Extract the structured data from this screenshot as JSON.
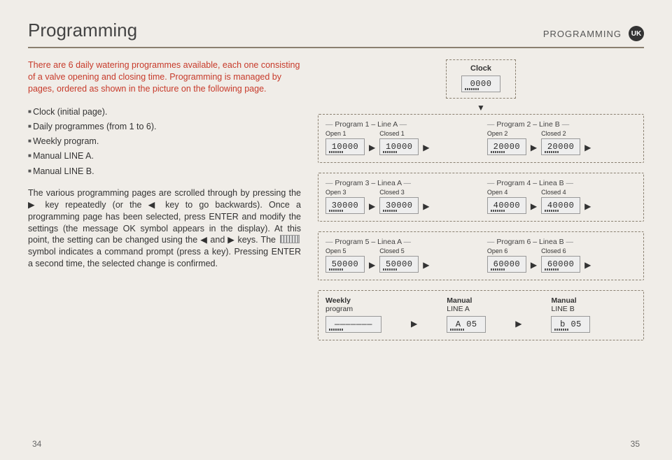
{
  "header": {
    "title": "Programming",
    "subtitle": "PROGRAMMING",
    "badge": "UK"
  },
  "intro": "There are 6 daily watering programmes available, each one consisting of a valve opening and closing time. Programming is managed by pages, ordered as shown in the picture on the following page.",
  "bullets": [
    "Clock (initial page).",
    "Daily programmes (from 1 to 6).",
    "Weekly program.",
    "Manual LINE A.",
    "Manual LINE B."
  ],
  "body": "The various programming pages are scrolled through by pressing the ▶ key repeatedly (or the ◀ key to go backwards). Once a programming page has been selected, press ENTER and modify the settings (the message OK symbol appears in the display). At this point, the setting can be changed using the ◀ and ▶ keys. The  symbol indicates a command prompt (press a key). Pressing ENTER a second time, the selected change is confirmed.",
  "body_before_sym": "The various programming pages are scrolled through by pressing the ▶ key repeatedly (or the ◀ key to go backwards). Once a programming page has been selected, press ENTER and modify the settings (the message OK symbol appears in the display). At this point, the setting can be changed using the ◀ and ▶ keys. The ",
  "body_after_sym": " symbol indicates a command prompt (press a key). Pressing ENTER a second time, the selected change is confirmed.",
  "clock": {
    "label": "Clock",
    "value": "0000"
  },
  "programs": [
    {
      "left": {
        "title": "Program 1 – Line A",
        "open_l": "Open 1",
        "open_v": "10000",
        "close_l": "Closed 1",
        "close_v": "10000"
      },
      "right": {
        "title": "Program 2 – Line B",
        "open_l": "Open 2",
        "open_v": "20000",
        "close_l": "Closed 2",
        "close_v": "20000"
      }
    },
    {
      "left": {
        "title": "Program 3 – Linea A",
        "open_l": "Open 3",
        "open_v": "30000",
        "close_l": "Closed 3",
        "close_v": "30000"
      },
      "right": {
        "title": "Program 4 – Linea B",
        "open_l": "Open 4",
        "open_v": "40000",
        "close_l": "Closed 4",
        "close_v": "40000"
      }
    },
    {
      "left": {
        "title": "Program 5 – Linea A",
        "open_l": "Open 5",
        "open_v": "50000",
        "close_l": "Closed 5",
        "close_v": "50000"
      },
      "right": {
        "title": "Program 6 – Linea B",
        "open_l": "Open 6",
        "open_v": "60000",
        "close_l": "Closed 6",
        "close_v": "60000"
      }
    }
  ],
  "weekly": {
    "g1": {
      "t1": "Weekly",
      "t2": "program",
      "lcd": "———————"
    },
    "g2": {
      "t1": "Manual",
      "t2": "LINE A",
      "lcd": "A  05"
    },
    "g3": {
      "t1": "Manual",
      "t2": "LINE B",
      "lcd": "b  05"
    }
  },
  "pages": {
    "left": "34",
    "right": "35"
  }
}
